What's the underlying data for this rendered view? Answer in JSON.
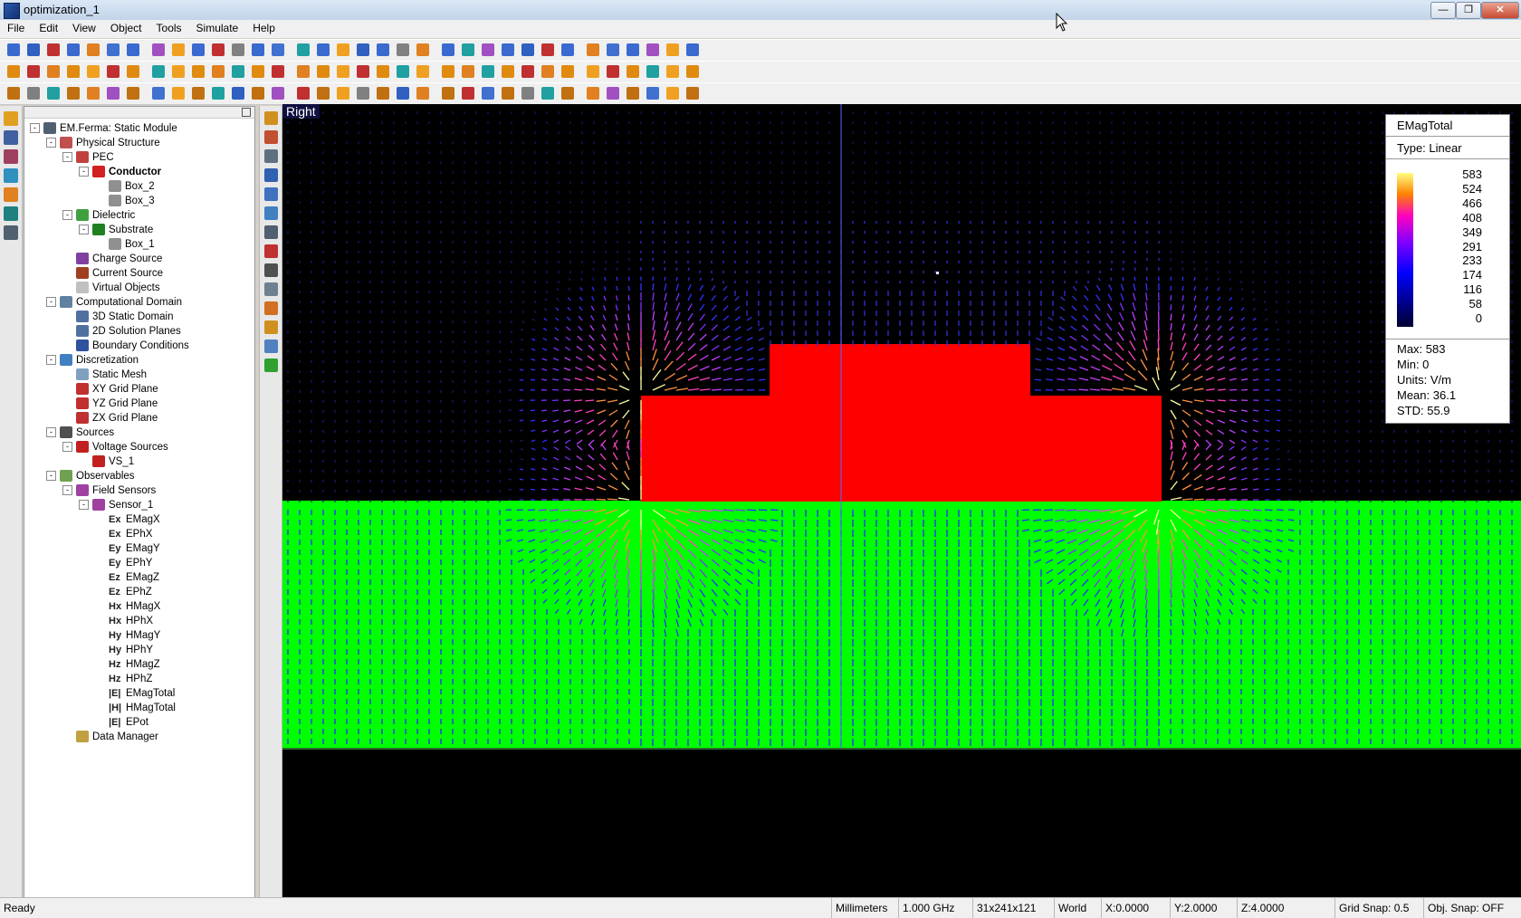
{
  "window": {
    "title": "optimization_1"
  },
  "menu": [
    "File",
    "Edit",
    "View",
    "Object",
    "Tools",
    "Simulate",
    "Help"
  ],
  "tree": [
    {
      "label": "EM.Ferma: Static Module",
      "level": 0,
      "expand": "-",
      "icon": "#506070"
    },
    {
      "label": "Physical Structure",
      "level": 1,
      "expand": "-",
      "icon": "#c05050"
    },
    {
      "label": "PEC",
      "level": 2,
      "expand": "-",
      "icon": "#c04040"
    },
    {
      "label": "Conductor",
      "level": 3,
      "expand": "-",
      "icon": "#d02020",
      "bold": true
    },
    {
      "label": "Box_2",
      "level": 4,
      "expand": "",
      "icon": "#909090"
    },
    {
      "label": "Box_3",
      "level": 4,
      "expand": "",
      "icon": "#909090"
    },
    {
      "label": "Dielectric",
      "level": 2,
      "expand": "-",
      "icon": "#40a040"
    },
    {
      "label": "Substrate",
      "level": 3,
      "expand": "-",
      "icon": "#208020"
    },
    {
      "label": "Box_1",
      "level": 4,
      "expand": "",
      "icon": "#909090"
    },
    {
      "label": "Charge Source",
      "level": 2,
      "expand": "",
      "icon": "#8040a0"
    },
    {
      "label": "Current Source",
      "level": 2,
      "expand": "",
      "icon": "#a04020"
    },
    {
      "label": "Virtual Objects",
      "level": 2,
      "expand": "",
      "icon": "#c0c0c0"
    },
    {
      "label": "Computational Domain",
      "level": 1,
      "expand": "-",
      "icon": "#6080a0"
    },
    {
      "label": "3D Static Domain",
      "level": 2,
      "expand": "",
      "icon": "#5070a0"
    },
    {
      "label": "2D Solution Planes",
      "level": 2,
      "expand": "",
      "icon": "#5070a0"
    },
    {
      "label": "Boundary Conditions",
      "level": 2,
      "expand": "",
      "icon": "#3050a0"
    },
    {
      "label": "Discretization",
      "level": 1,
      "expand": "-",
      "icon": "#4080c0"
    },
    {
      "label": "Static Mesh",
      "level": 2,
      "expand": "",
      "icon": "#80a0c0"
    },
    {
      "label": "XY Grid Plane",
      "level": 2,
      "expand": "",
      "icon": "#c03030"
    },
    {
      "label": "YZ Grid Plane",
      "level": 2,
      "expand": "",
      "icon": "#c03030"
    },
    {
      "label": "ZX Grid Plane",
      "level": 2,
      "expand": "",
      "icon": "#c03030"
    },
    {
      "label": "Sources",
      "level": 1,
      "expand": "-",
      "icon": "#505050"
    },
    {
      "label": "Voltage Sources",
      "level": 2,
      "expand": "-",
      "icon": "#c02020"
    },
    {
      "label": "VS_1",
      "level": 3,
      "expand": "",
      "icon": "#c02020"
    },
    {
      "label": "Observables",
      "level": 1,
      "expand": "-",
      "icon": "#70a050"
    },
    {
      "label": "Field Sensors",
      "level": 2,
      "expand": "-",
      "icon": "#a040a0"
    },
    {
      "label": "Sensor_1",
      "level": 3,
      "expand": "-",
      "icon": "#a040a0"
    },
    {
      "label": "EMagX",
      "level": 4,
      "expand": "",
      "field": "Ex"
    },
    {
      "label": "EPhX",
      "level": 4,
      "expand": "",
      "field": "Ex"
    },
    {
      "label": "EMagY",
      "level": 4,
      "expand": "",
      "field": "Ey"
    },
    {
      "label": "EPhY",
      "level": 4,
      "expand": "",
      "field": "Ey"
    },
    {
      "label": "EMagZ",
      "level": 4,
      "expand": "",
      "field": "Ez"
    },
    {
      "label": "EPhZ",
      "level": 4,
      "expand": "",
      "field": "Ez"
    },
    {
      "label": "HMagX",
      "level": 4,
      "expand": "",
      "field": "Hx"
    },
    {
      "label": "HPhX",
      "level": 4,
      "expand": "",
      "field": "Hx"
    },
    {
      "label": "HMagY",
      "level": 4,
      "expand": "",
      "field": "Hy"
    },
    {
      "label": "HPhY",
      "level": 4,
      "expand": "",
      "field": "Hy"
    },
    {
      "label": "HMagZ",
      "level": 4,
      "expand": "",
      "field": "Hz"
    },
    {
      "label": "HPhZ",
      "level": 4,
      "expand": "",
      "field": "Hz"
    },
    {
      "label": "EMagTotal",
      "level": 4,
      "expand": "",
      "field": "|E|"
    },
    {
      "label": "HMagTotal",
      "level": 4,
      "expand": "",
      "field": "|H|"
    },
    {
      "label": "EPot",
      "level": 4,
      "expand": "",
      "field": "|E|"
    },
    {
      "label": "Data Manager",
      "level": 2,
      "expand": "",
      "icon": "#c0a040"
    }
  ],
  "viewport": {
    "view_label": "Right",
    "colors": {
      "background": "#000000",
      "substrate": "#00ff00",
      "conductor": "#ff0000",
      "guide": "#6060ff"
    }
  },
  "legend": {
    "title": "EMagTotal",
    "type": "Type: Linear",
    "ticks": [
      "583",
      "524",
      "466",
      "408",
      "349",
      "291",
      "233",
      "174",
      "116",
      "58",
      "0"
    ],
    "stats": [
      "Max: 583",
      "Min: 0",
      "Units: V/m",
      "Mean: 36.1",
      "STD: 55.9"
    ]
  },
  "status": {
    "ready": "Ready",
    "units": "Millimeters",
    "freq": "1.000 GHz",
    "grid": "31x241x121",
    "frame": "World",
    "x": "X:0.0000",
    "y": "Y:2.0000",
    "z": "Z:4.0000",
    "grid_snap": "Grid Snap: 0.5",
    "obj_snap": "Obj. Snap: OFF"
  }
}
